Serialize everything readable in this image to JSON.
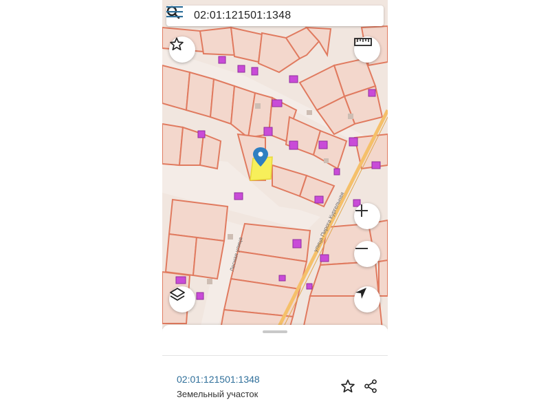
{
  "search": {
    "query": "02:01:121501:1348",
    "icon": "search-icon"
  },
  "map": {
    "street_labels": [
      "Лесная улица",
      "улица Пирога Кургельная"
    ],
    "watermark": "",
    "colors": {
      "background": "#f1e6df",
      "parcel_fill": "#f3d7cc",
      "parcel_border": "#e07a5f",
      "building": "#c94bd8",
      "selected_parcel": "#f7ef5a",
      "road": "#f5c06a",
      "marker": "#2f7fc1"
    },
    "controls": [
      "star-icon",
      "ruler-icon",
      "zoom-in-icon",
      "zoom-out-icon",
      "layers-icon",
      "navigation-arrow-icon"
    ]
  },
  "info_panel": {
    "parcel_id": "02:01:121501:1348",
    "parcel_type": "Земельный участок"
  }
}
